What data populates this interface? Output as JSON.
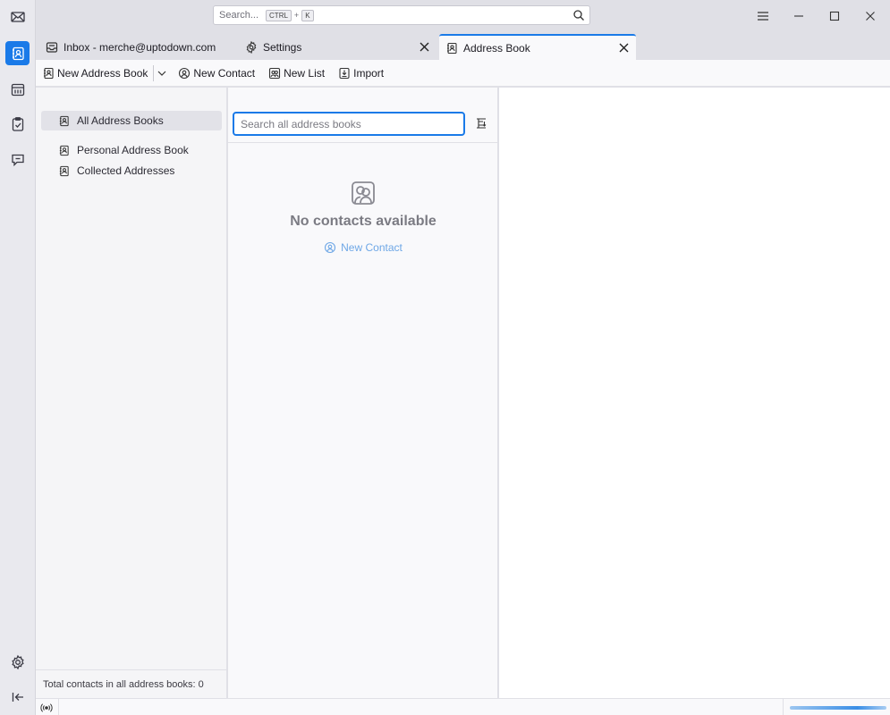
{
  "spaces": {
    "items": [
      {
        "name": "mail",
        "icon": "envelope-icon",
        "active": false
      },
      {
        "name": "address-book",
        "icon": "address-book-icon",
        "active": true
      },
      {
        "name": "calendar",
        "icon": "calendar-icon",
        "active": false
      },
      {
        "name": "tasks",
        "icon": "clipboard-check-icon",
        "active": false
      },
      {
        "name": "chat",
        "icon": "chat-icon",
        "active": false
      }
    ],
    "settings_icon": "gear-icon",
    "collapse_icon": "collapse-left-icon"
  },
  "titlebar": {
    "search_placeholder": "Search...",
    "shortcut_key1": "CTRL",
    "shortcut_plus": "+",
    "shortcut_key2": "K"
  },
  "tabs": [
    {
      "label": "Inbox - merche@uptodown.com",
      "icon": "inbox-icon",
      "selected": false
    },
    {
      "label": "Settings",
      "icon": "gear-icon",
      "selected": false
    },
    {
      "label": "Address Book",
      "icon": "address-book-icon",
      "selected": true
    }
  ],
  "toolbar": {
    "new_address_book": "New Address Book",
    "new_contact": "New Contact",
    "new_list": "New List",
    "import": "Import"
  },
  "books": {
    "items": [
      {
        "label": "All Address Books",
        "selected": true
      },
      {
        "label": "Personal Address Book",
        "selected": false
      },
      {
        "label": "Collected Addresses",
        "selected": false
      }
    ],
    "footer": "Total contacts in all address books: 0"
  },
  "list": {
    "search_placeholder": "Search all address books",
    "search_value": "",
    "empty_text": "No contacts available",
    "empty_new_contact": "New Contact"
  },
  "status": {
    "progress": 1.0
  },
  "colors": {
    "accent": "#1a7ae8",
    "link": "#6ea7e6"
  }
}
